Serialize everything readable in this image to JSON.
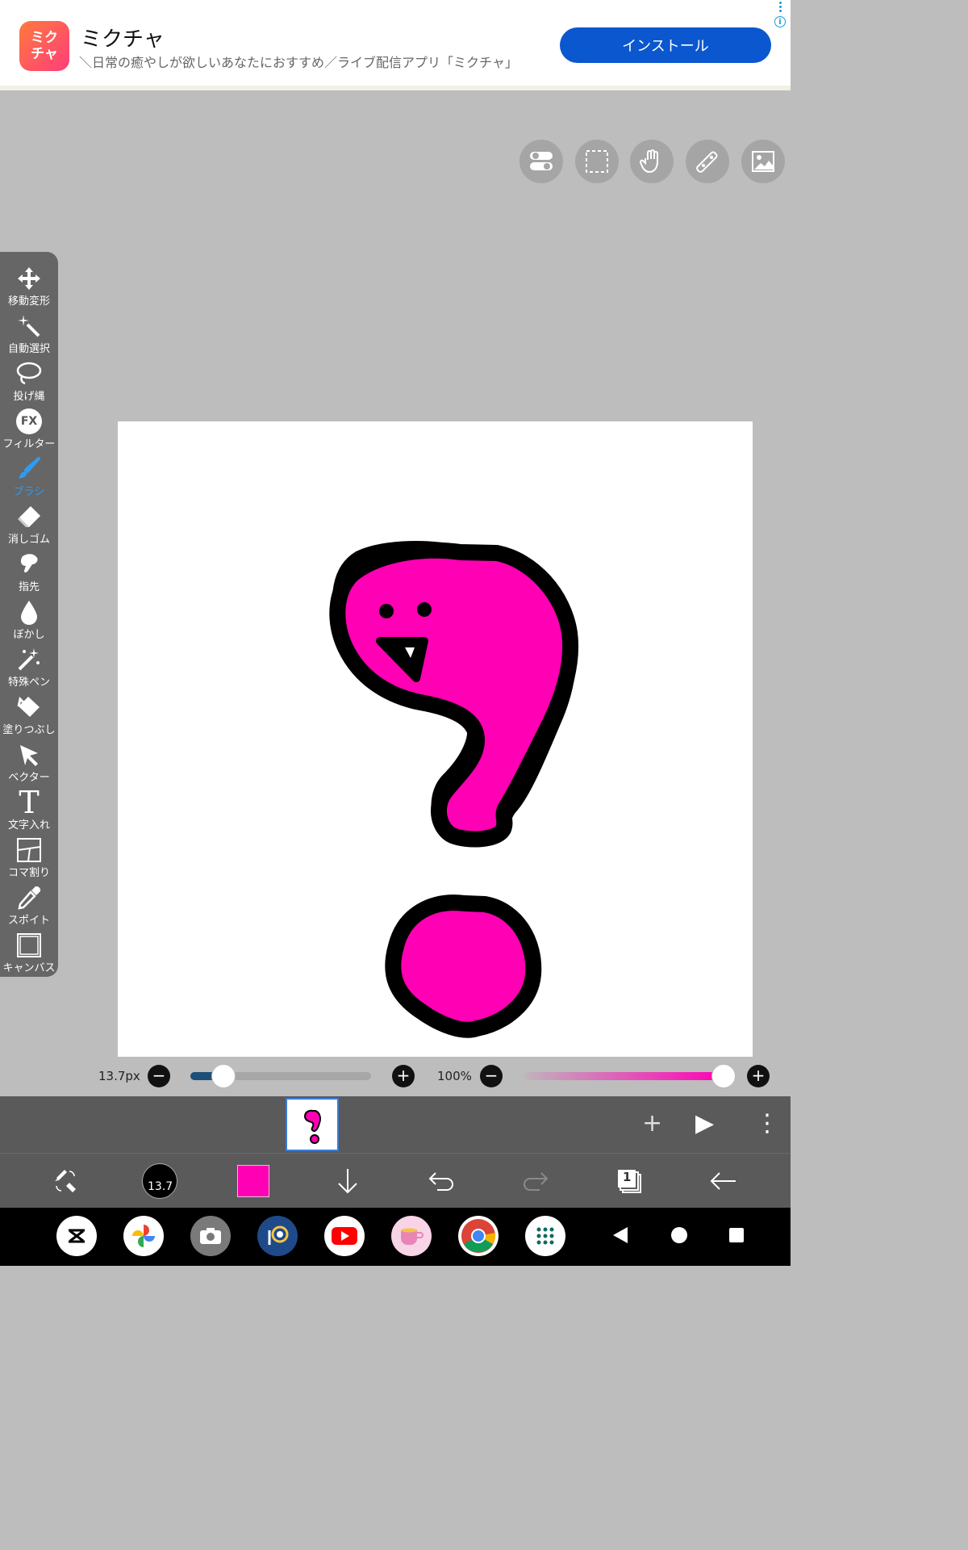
{
  "ad": {
    "logo_text": "ミク\nチャ",
    "title": "ミクチャ",
    "description": "＼日常の癒やしが欲しいあなたにおすすめ／ライブ配信アプリ「ミクチャ」",
    "install_label": "インストール",
    "info_glyph": "i"
  },
  "tools": [
    {
      "label": "移動変形",
      "icon": "move-icon"
    },
    {
      "label": "自動選択",
      "icon": "magic-wand-icon"
    },
    {
      "label": "投げ縄",
      "icon": "lasso-icon"
    },
    {
      "label": "フィルター",
      "icon": "fx-icon"
    },
    {
      "label": "ブラシ",
      "icon": "brush-icon"
    },
    {
      "label": "消しゴム",
      "icon": "eraser-icon"
    },
    {
      "label": "指先",
      "icon": "finger-icon"
    },
    {
      "label": "ぼかし",
      "icon": "blur-drop-icon"
    },
    {
      "label": "特殊ペン",
      "icon": "special-pen-icon"
    },
    {
      "label": "塗りつぶし",
      "icon": "fill-bucket-icon"
    },
    {
      "label": "ベクター",
      "icon": "vector-icon"
    },
    {
      "label": "文字入れ",
      "icon": "text-icon"
    },
    {
      "label": "コマ割り",
      "icon": "frame-divide-icon"
    },
    {
      "label": "スポイト",
      "icon": "eyedropper-icon"
    },
    {
      "label": "キャンバス",
      "icon": "canvas-icon"
    }
  ],
  "fx_text": "FX",
  "text_tool_glyph": "T",
  "active_tool": "ブラシ",
  "brush": {
    "size_label": "13.7px",
    "size_fraction": 0.13,
    "opacity_label": "100%",
    "opacity_fraction": 1.0,
    "color": "#ff00b4",
    "preview_size": "13.7"
  },
  "controls": {
    "minus": "−",
    "plus": "+"
  },
  "frames_bar": {
    "add": "+",
    "play": "▶",
    "more": "⋮"
  },
  "layers": {
    "count": "1"
  },
  "colors": {
    "accent": "#2f9bf0",
    "toolbar_bg": "#666666",
    "magenta": "#ff00b4"
  }
}
